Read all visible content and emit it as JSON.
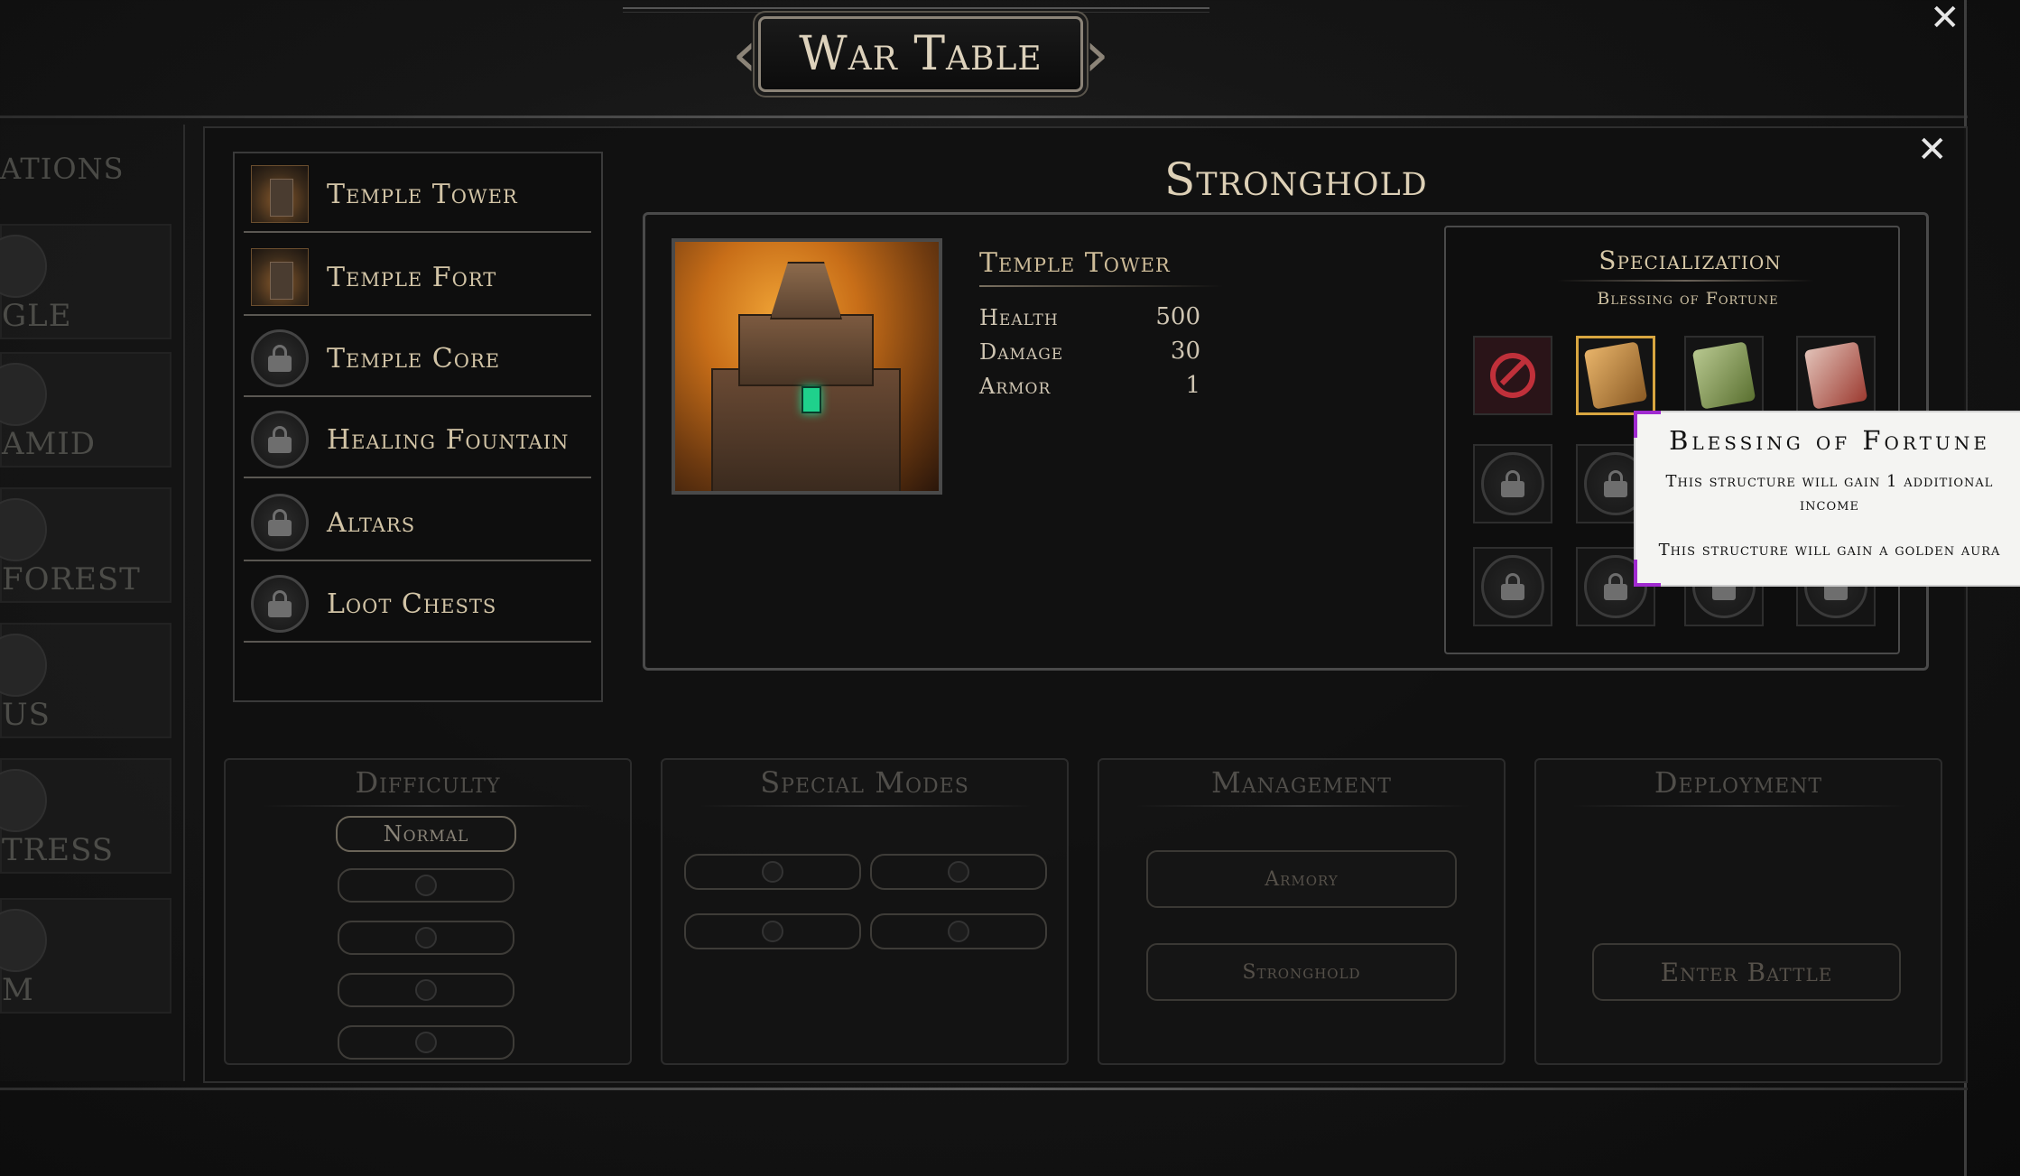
{
  "header": {
    "title": "War Table"
  },
  "left_maps": {
    "heading": "ATIONS",
    "items": [
      {
        "label": "GLE"
      },
      {
        "label": "AMID"
      },
      {
        "label": "FOREST"
      },
      {
        "label": "US"
      },
      {
        "label": "TRESS"
      },
      {
        "label": "M"
      }
    ]
  },
  "structures": [
    {
      "label": "Temple Tower",
      "locked": false,
      "selected": true
    },
    {
      "label": "Temple Fort",
      "locked": false
    },
    {
      "label": "Temple Core",
      "locked": true
    },
    {
      "label": "Healing Fountain",
      "locked": true
    },
    {
      "label": "Altars",
      "locked": true
    },
    {
      "label": "Loot Chests",
      "locked": true
    }
  ],
  "detail": {
    "title": "Stronghold",
    "name": "Temple Tower",
    "stats": [
      {
        "label": "Health",
        "value": "500"
      },
      {
        "label": "Damage",
        "value": "30"
      },
      {
        "label": "Armor",
        "value": "1"
      }
    ]
  },
  "specialization": {
    "title": "Specialization",
    "selected": "Blessing of Fortune"
  },
  "tooltip": {
    "title": "Blessing of Fortune",
    "line1": "This structure will gain 1 additional income",
    "line2": "This structure will gain a golden aura"
  },
  "bottom": {
    "difficulty": {
      "heading": "Difficulty",
      "selected": "Normal"
    },
    "special_modes": {
      "heading": "Special Modes"
    },
    "management": {
      "heading": "Management",
      "armory": "Armory",
      "stronghold": "Stronghold"
    },
    "deployment": {
      "heading": "Deployment",
      "enter_battle": "Enter Battle"
    }
  },
  "colors": {
    "accent_gold": "#d8a640",
    "tooltip_corner": "#a02ad0",
    "none_red": "#c0303a",
    "gem_green": "#1fd18c"
  }
}
